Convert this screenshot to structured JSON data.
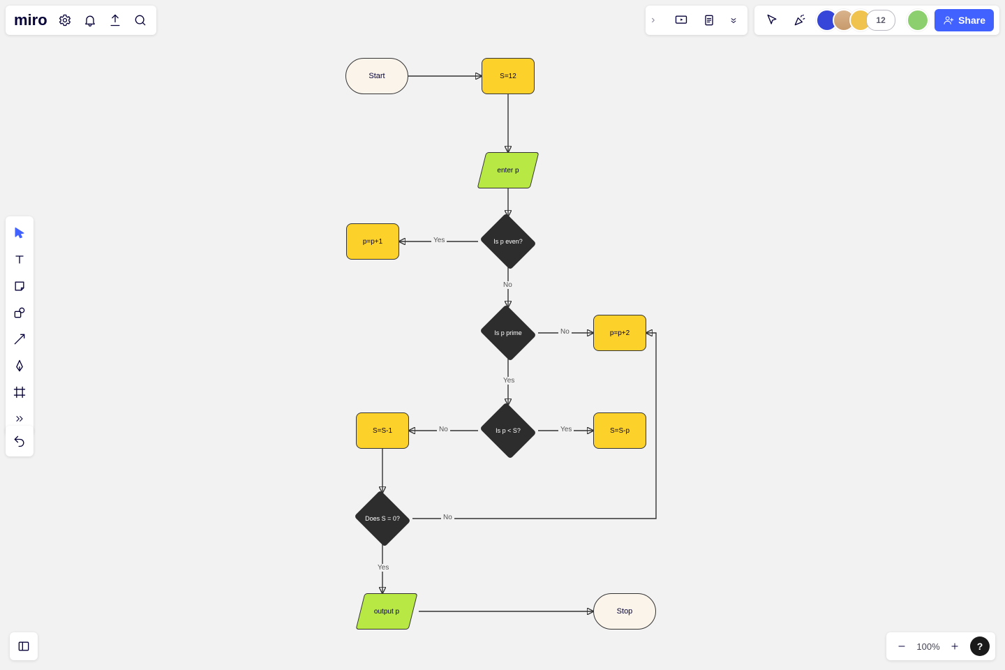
{
  "app": {
    "logo_text": "miro"
  },
  "topright": {
    "share_label": "Share",
    "extra_count": "12"
  },
  "zoom": {
    "percent": "100%"
  },
  "help": {
    "label": "?"
  },
  "flow": {
    "start": "Start",
    "s12": "S=12",
    "enter_p": "enter p",
    "is_even": "Is p even?",
    "pp1": "p=p+1",
    "is_prime": "Is p prime",
    "pp2": "p=p+2",
    "p_lt_s": "Is p < S?",
    "s_minus1": "S=S-1",
    "s_minus_p": "S=S-p",
    "s_zero": "Does S = 0?",
    "output": "output p",
    "stop": "Stop"
  },
  "labels": {
    "yes": "Yes",
    "no": "No"
  },
  "colors": {
    "accent": "#4262FF",
    "yellow": "#FBD12A",
    "green": "#B7E843",
    "dark": "#2D2D2D",
    "cream": "#FAF4EB"
  }
}
